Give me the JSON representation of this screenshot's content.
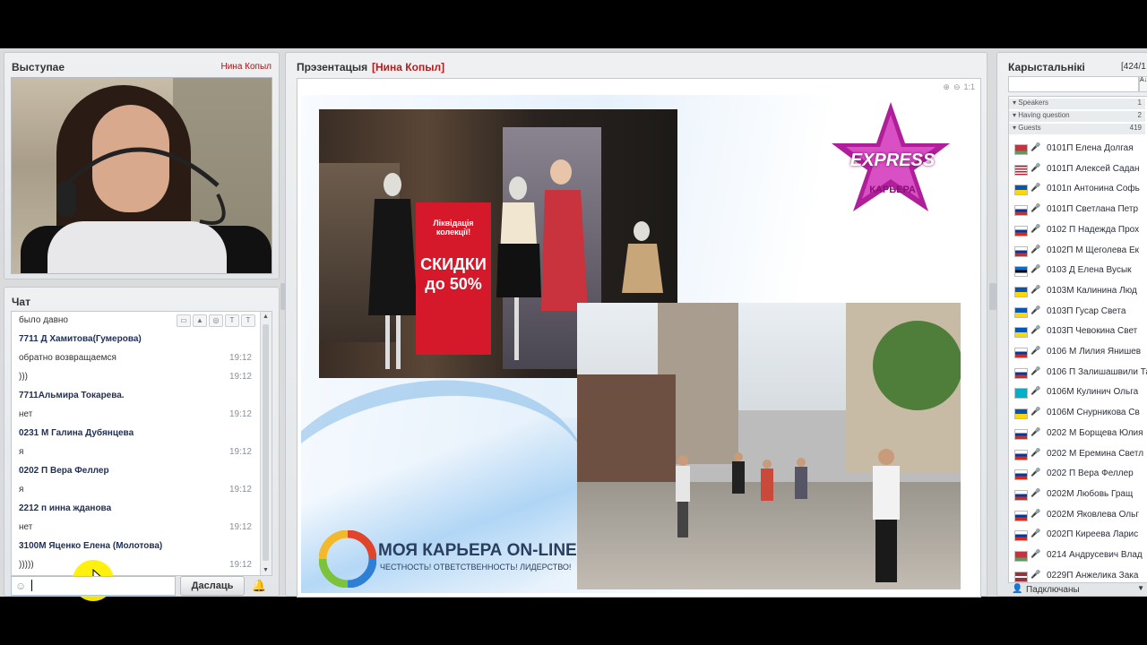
{
  "speaker": {
    "title": "Выступае",
    "name": "Нина Копыл"
  },
  "chat": {
    "title": "Чат",
    "messages": [
      {
        "text": "было давно",
        "time": "",
        "bold": false
      },
      {
        "text": "7711 Д Хамитова(Гумерова)",
        "time": "",
        "bold": true
      },
      {
        "text": "обратно возвращаемся",
        "time": "19:12",
        "bold": false
      },
      {
        "text": ")))",
        "time": "19:12",
        "bold": false
      },
      {
        "text": "7711Альмира Токарева.",
        "time": "",
        "bold": true
      },
      {
        "text": "нет",
        "time": "19:12",
        "bold": false
      },
      {
        "text": "0231 М Галина Дубянцева",
        "time": "",
        "bold": true
      },
      {
        "text": "я",
        "time": "19:12",
        "bold": false
      },
      {
        "text": "0202 П Вера Феллер",
        "time": "",
        "bold": true
      },
      {
        "text": "я",
        "time": "19:12",
        "bold": false
      },
      {
        "text": "2212 п инна жданова",
        "time": "",
        "bold": true
      },
      {
        "text": "нет",
        "time": "19:12",
        "bold": false
      },
      {
        "text": "3100М Яценко Елена (Молотова)",
        "time": "",
        "bold": true
      },
      {
        "text": ")))))",
        "time": "19:12",
        "bold": false
      }
    ],
    "send_label": "Даслаць",
    "input_value": ""
  },
  "presentation": {
    "title": "Прэзентацыя",
    "presenter": "[Нина Копыл]",
    "zoom_labels": [
      "1:1"
    ],
    "slide": {
      "sign_top": "Ліквідація колекції!",
      "sign_main": "СКИДКИ до 50%",
      "logo_express": "EXPRESS",
      "logo_career": "КАРЬЕРА",
      "brand_title": "МОЯ КАРЬЕРА ON-LINE",
      "brand_sub": "ЧЕСТНОСТЬ! ОТВЕТСТВЕННОСТЬ! ЛИДЕРСТВО!"
    }
  },
  "users": {
    "title": "Карыстальнікі",
    "count": "[424/1",
    "groups": [
      {
        "name": "Speakers",
        "count": "1"
      },
      {
        "name": "Having question",
        "count": "2"
      },
      {
        "name": "Guests",
        "count": "419"
      }
    ],
    "list": [
      {
        "name": "0101П  Елена Долгая",
        "flag": "by"
      },
      {
        "name": "0101П  Алексей Садан",
        "flag": "us"
      },
      {
        "name": "0101п Антонина Софь",
        "flag": "ua"
      },
      {
        "name": "0101П Светлана Петр",
        "flag": "ru"
      },
      {
        "name": "0102 П Надежда Прох",
        "flag": "ru"
      },
      {
        "name": "0102П М Щеголева Ек",
        "flag": "ru"
      },
      {
        "name": "0103 Д Елена Вусык",
        "flag": "ee"
      },
      {
        "name": "0103М Калинина Люд",
        "flag": "ua"
      },
      {
        "name": "0103П Гусар Света",
        "flag": "ua"
      },
      {
        "name": "0103П Чевокина Свет",
        "flag": "ua"
      },
      {
        "name": "0106 М Лилия Янишев",
        "flag": "ru"
      },
      {
        "name": "0106 П Залишашвили Та",
        "flag": "ru"
      },
      {
        "name": "0106М Кулинич Ольга",
        "flag": "kz"
      },
      {
        "name": "0106М Снурникова Св",
        "flag": "ua"
      },
      {
        "name": "0202 М Борщева Юлия",
        "flag": "ru"
      },
      {
        "name": "0202 М Еремина Светл",
        "flag": "ru"
      },
      {
        "name": "0202 П Вера Феллер",
        "flag": "ru"
      },
      {
        "name": "0202М Любовь Гращ",
        "flag": "ru"
      },
      {
        "name": "0202М Яковлева Ольг",
        "flag": "ru"
      },
      {
        "name": "0202П Киреева Ларис",
        "flag": "ru"
      },
      {
        "name": "0214 Андрусевич Влад",
        "flag": "by"
      },
      {
        "name": "0229П Анжелика Зака",
        "flag": "lv"
      }
    ],
    "footer": "Падключаны"
  }
}
